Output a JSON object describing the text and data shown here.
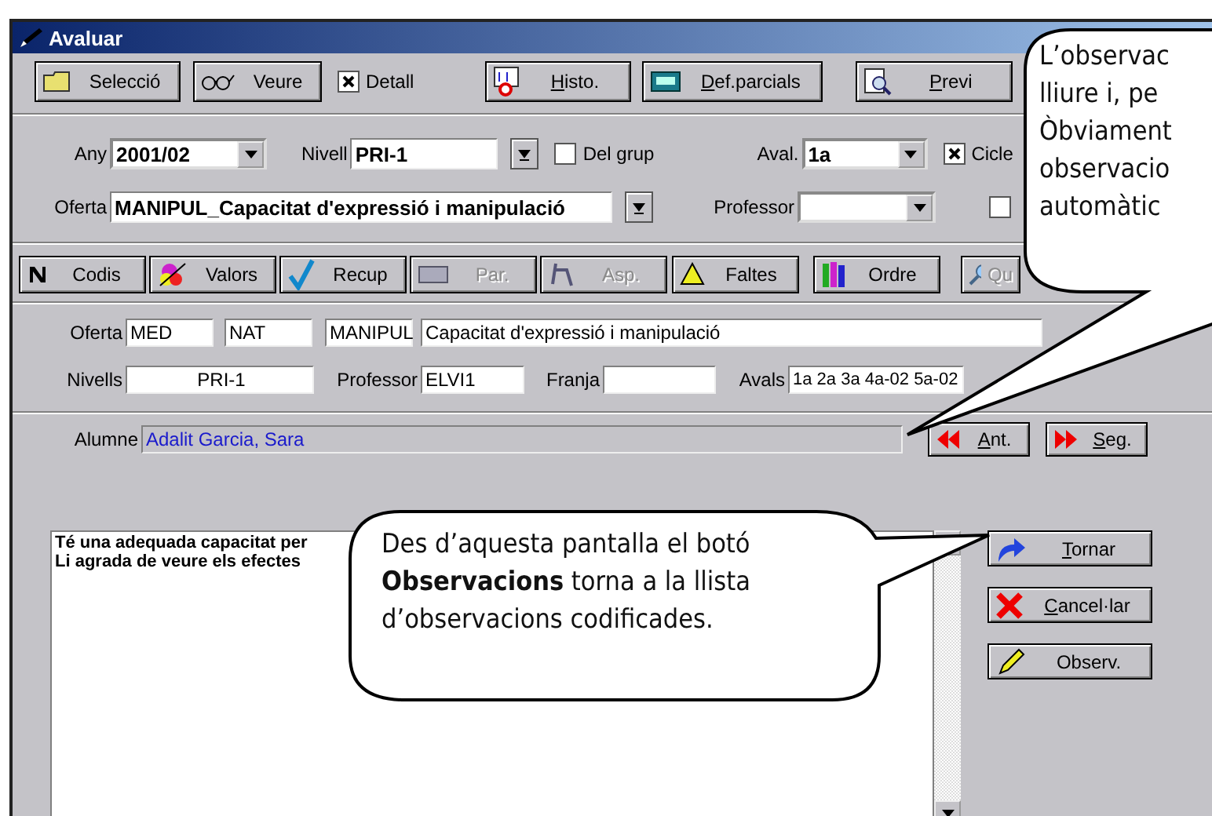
{
  "window": {
    "title": "Avaluar"
  },
  "toolbar": [
    {
      "kind": "button",
      "label": "Selecció",
      "underline_first": false
    },
    {
      "kind": "button",
      "label": "Veure",
      "underline_first": false
    },
    {
      "kind": "checkbox",
      "label": "Detall",
      "checked": true
    },
    {
      "kind": "button",
      "label": "Histo.",
      "underline_first": true
    },
    {
      "kind": "button",
      "label": "Def.parcials",
      "underline_first": true
    },
    {
      "kind": "button",
      "label": "Previ",
      "underline_first": true
    }
  ],
  "filters": {
    "any": {
      "label": "Any",
      "value": "2001/02"
    },
    "nivell": {
      "label": "Nivell",
      "value": "PRI-1"
    },
    "del_grup": {
      "label": "Del grup",
      "checked": false
    },
    "aval": {
      "label": "Aval.",
      "value": "1a"
    },
    "cicle": {
      "label": "Cicle",
      "checked": true
    },
    "oferta": {
      "label": "Oferta",
      "value": "MANIPUL_Capacitat d'expressió i manipulació"
    },
    "professor": {
      "label": "Professor"
    },
    "extra_checkbox": {
      "checked": false
    }
  },
  "toolbar2": [
    {
      "label": "Codis",
      "disabled": false
    },
    {
      "label": "Valors",
      "disabled": false
    },
    {
      "label": "Recup",
      "disabled": false
    },
    {
      "label": "Par.",
      "disabled": true
    },
    {
      "label": "Asp.",
      "disabled": true
    },
    {
      "label": "Faltes",
      "disabled": false
    },
    {
      "label": "Ordre",
      "disabled": false
    },
    {
      "label": "Qu",
      "disabled": true
    }
  ],
  "detail": {
    "oferta_label": "Oferta",
    "oferta_fields": [
      "MED",
      "NAT",
      "MANIPUL",
      "Capacitat d'expressió i manipulació"
    ],
    "nivells": {
      "label": "Nivells",
      "value": "PRI-1"
    },
    "professor": {
      "label": "Professor",
      "value": "ELVI1"
    },
    "franja": {
      "label": "Franja"
    },
    "avals": {
      "label": "Avals",
      "value": "1a 2a 3a 4a-02 5a-02"
    }
  },
  "alumne": {
    "label": "Alumne",
    "value": "Adalit Garcia, Sara"
  },
  "nav_buttons": [
    {
      "label": "Ant.",
      "underline_first": true
    },
    {
      "label": "Seg.",
      "underline_first": true
    }
  ],
  "observations": [
    "Té una adequada capacitat per",
    "Li agrada de veure els efectes"
  ],
  "side_buttons": [
    {
      "label": "Tornar",
      "underline_first": true
    },
    {
      "label": "Cancel·lar",
      "underline_first": true
    },
    {
      "label": "Observ.",
      "underline_first": false
    }
  ],
  "callouts": [
    {
      "lines": [
        "L’observac",
        "lliure i, pe",
        "Òbviament",
        "observacio",
        "automàtic"
      ]
    },
    {
      "lines": [
        "Des d’aquesta pantalla el botó",
        "**Observacions** torna a la llista",
        "d’observacions codificades."
      ]
    }
  ]
}
